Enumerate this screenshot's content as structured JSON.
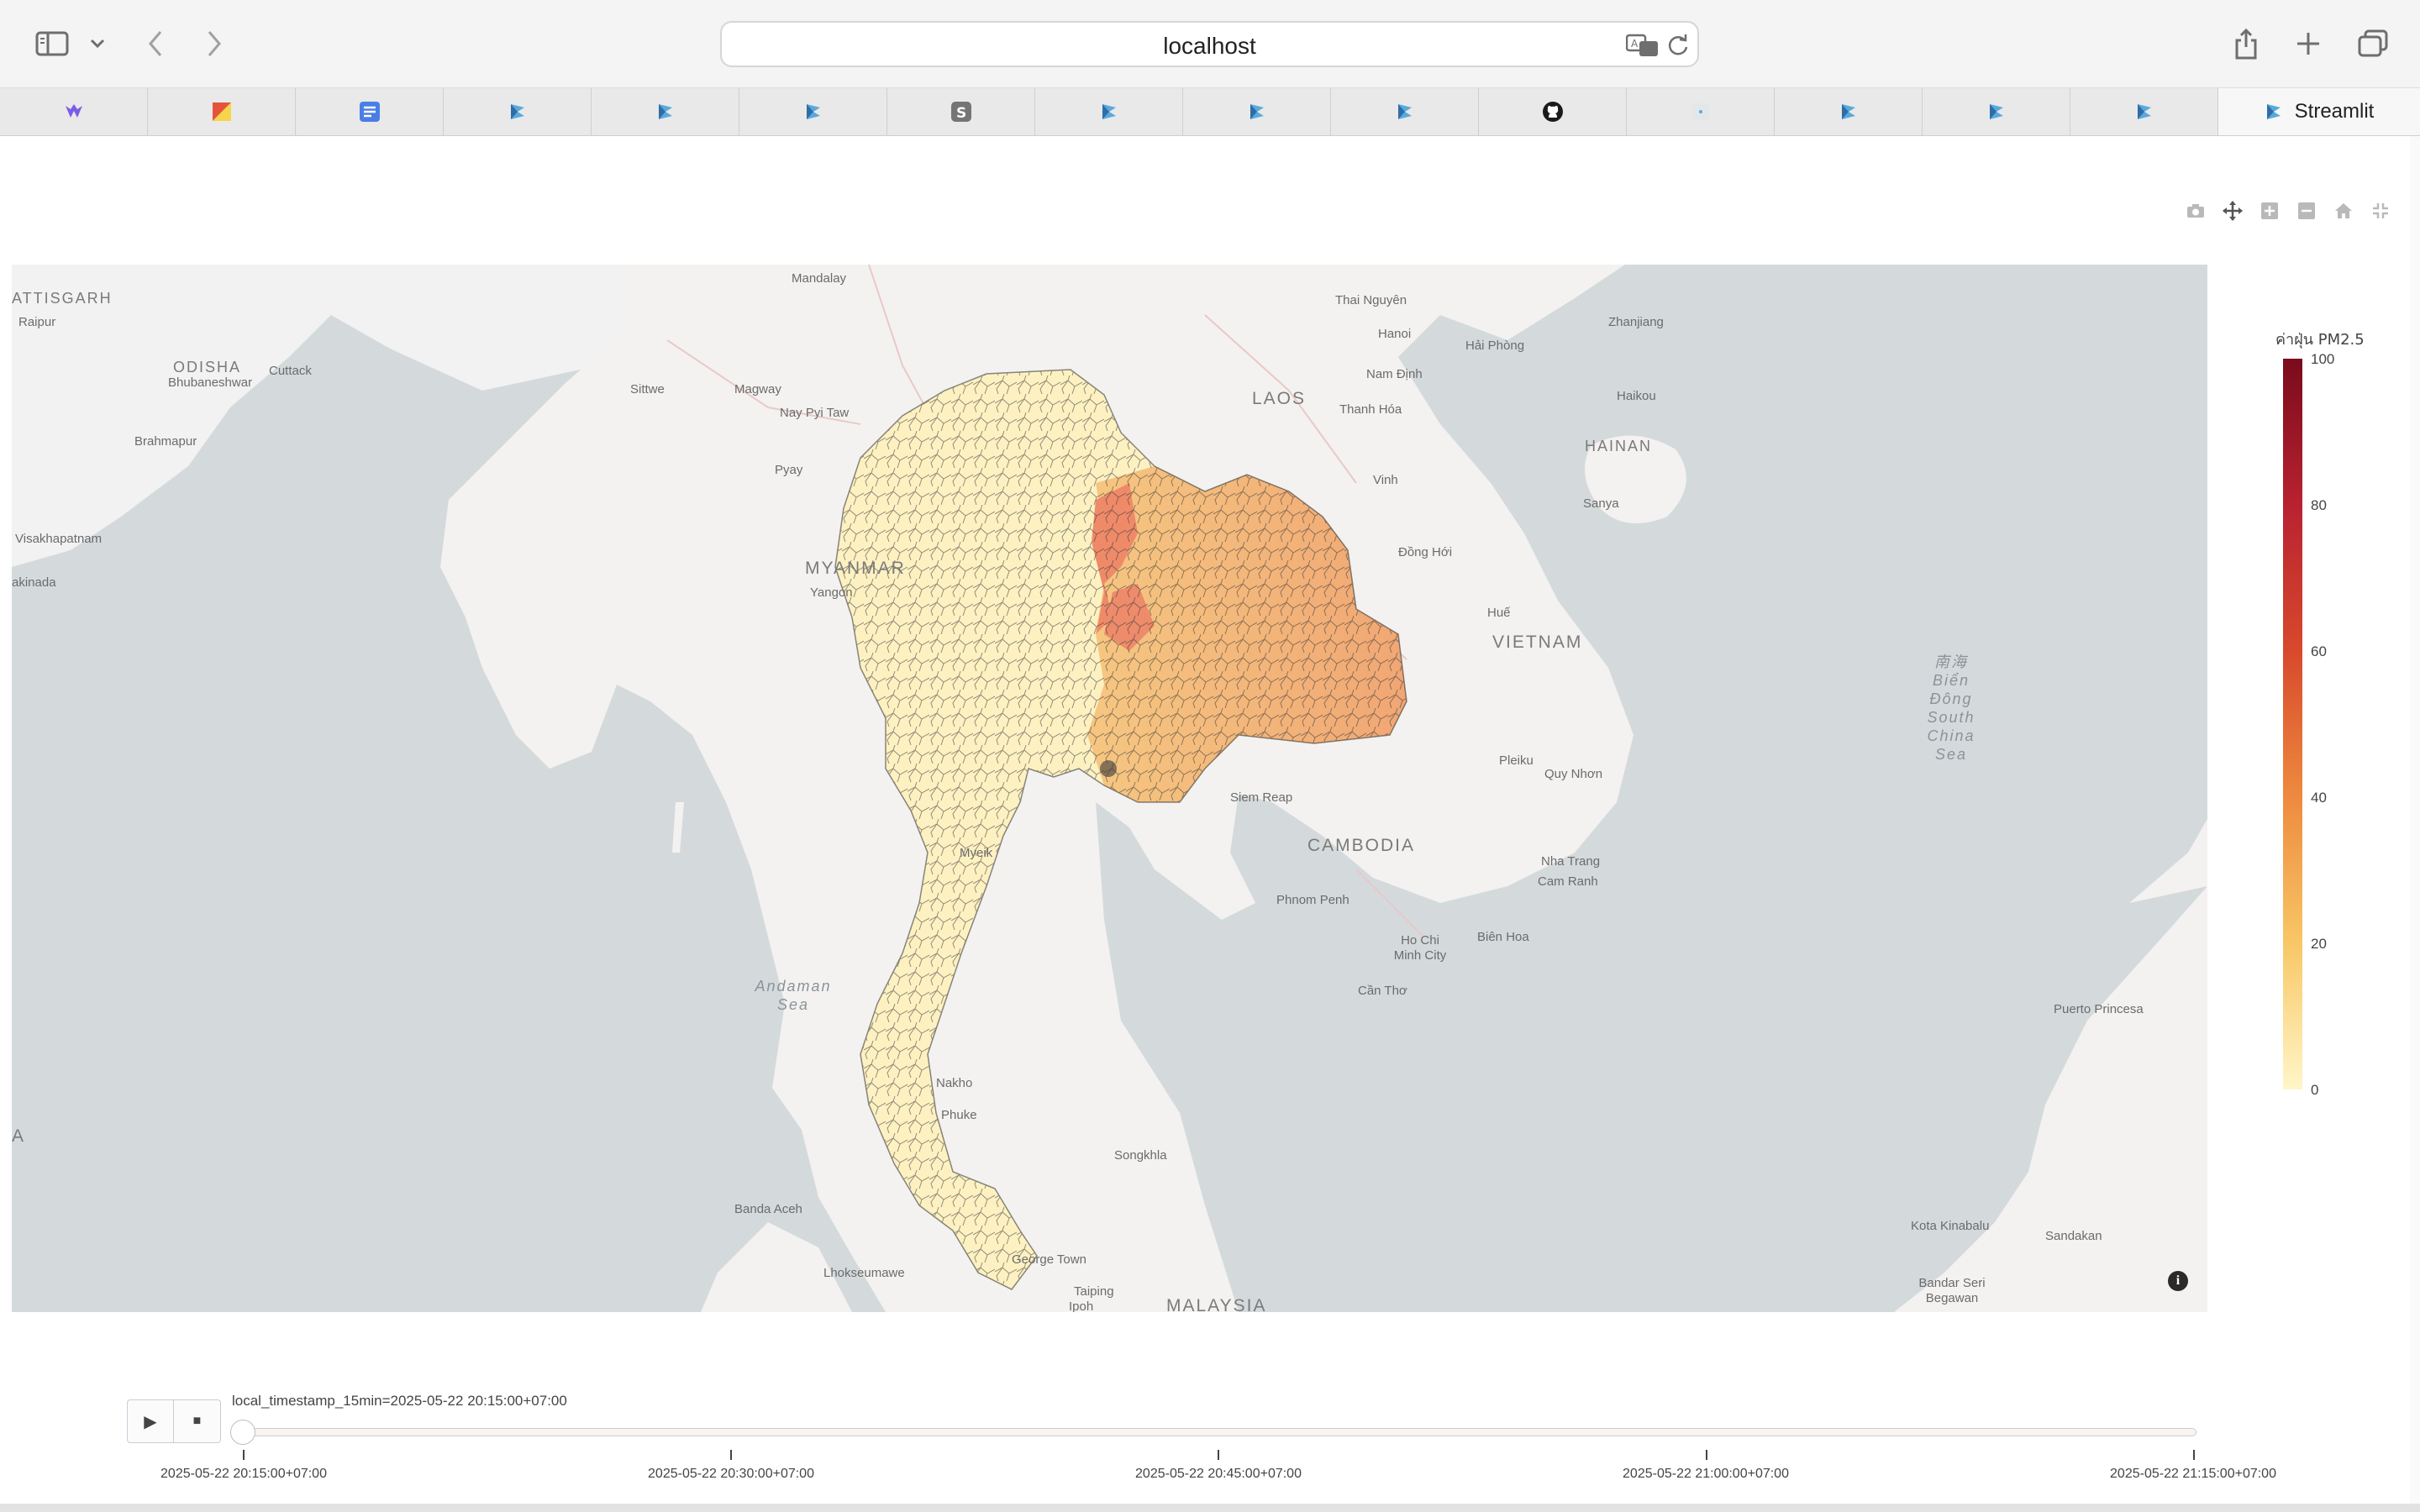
{
  "browser": {
    "url": "localhost",
    "active_tab_label": "Streamlit",
    "tab_icons": [
      "logo-icon-purple",
      "gmail-icon",
      "docs-icon",
      "streamlit-icon",
      "streamlit-icon",
      "streamlit-icon",
      "s-icon",
      "streamlit-icon",
      "streamlit-icon",
      "streamlit-icon",
      "github-icon",
      "blank-icon",
      "streamlit-icon",
      "streamlit-icon",
      "streamlit-icon"
    ]
  },
  "map": {
    "countries": [
      "LAOS",
      "MYANMAR",
      "VIETNAM",
      "CAMBODIA",
      "HAINAN",
      "MALAYSIA"
    ],
    "cities": [
      "Mandalay",
      "Thai Nguyên",
      "Hanoi",
      "Hải Phòng",
      "Zhanjiang",
      "Nam Định",
      "Thanh Hóa",
      "Haikou",
      "Sittwe",
      "Magway",
      "Nay Pyi Taw",
      "Vinh",
      "Sanya",
      "Pyay",
      "Đồng Hới",
      "Yangon",
      "Huế",
      "Pleiku",
      "Quy Nhơn",
      "Siem Reap",
      "Nha Trang",
      "Cam Ranh",
      "Phnom Penh",
      "Ho Chi Minh City",
      "Biên Hoa",
      "Cần Thơ",
      "Myeik",
      "Songkhla",
      "Banda Aceh",
      "Lhokseumawe",
      "George Town",
      "Taiping",
      "Ipoh",
      "Kota Kinabalu",
      "Sandakan",
      "Bandar Seri Begawan",
      "Puerto Princesa",
      "ATTISGARH",
      "Raipur",
      "ODISHA",
      "Cuttack",
      "Bhubaneshwar",
      "Brahmapur",
      "Visakhapatnam",
      "akinada",
      "Nakho",
      "Phuke",
      "A"
    ],
    "seas": [
      "Andaman Sea",
      "南海 Biển Đông South China Sea"
    ],
    "colorbar": {
      "title": "ค่าฝุ่น PM2.5",
      "ticks": [
        "100",
        "80",
        "60",
        "40",
        "20",
        "0"
      ],
      "range": [
        0,
        100
      ],
      "colors": [
        "#fff6c8",
        "#f8c766",
        "#ee8a3f",
        "#d8492c",
        "#b82230",
        "#7a0b1c"
      ]
    }
  },
  "slider": {
    "current_label": "local_timestamp_15min=2025-05-22 20:15:00+07:00",
    "play_label": "▶",
    "stop_label": "■",
    "position": 0,
    "steps": [
      "2025-05-22 20:15:00+07:00",
      "2025-05-22 20:30:00+07:00",
      "2025-05-22 20:45:00+07:00",
      "2025-05-22 21:00:00+07:00",
      "2025-05-22 21:15:00+07:00"
    ]
  }
}
